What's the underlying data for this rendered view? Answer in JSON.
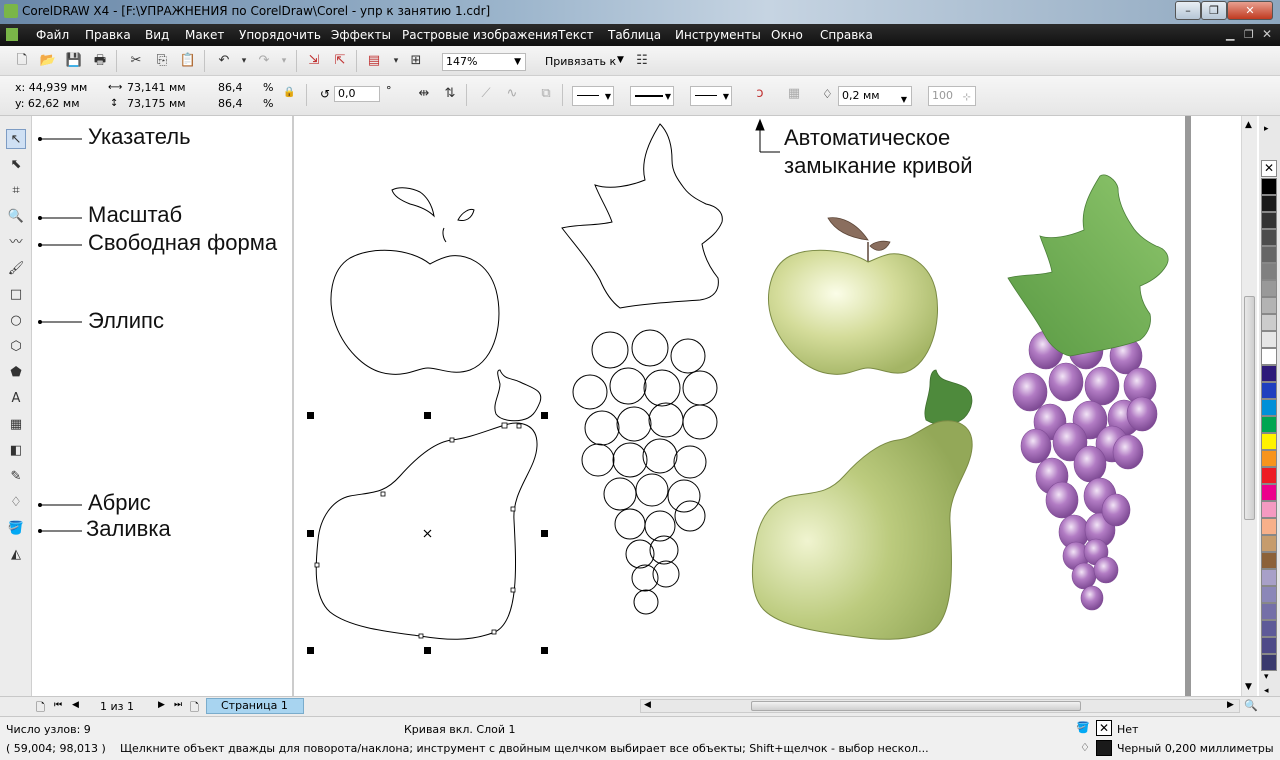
{
  "window": {
    "title": "CorelDRAW X4 - [F:\\УПРАЖНЕНИЯ по CorelDraw\\Corel - упр к занятию 1.cdr]",
    "controls": [
      "–",
      "❐",
      "✕"
    ]
  },
  "menu": [
    "Файл",
    "Правка",
    "Вид",
    "Макет",
    "Упорядочить",
    "Эффекты",
    "Растровые изображения",
    "Текст",
    "Таблица",
    "Инструменты",
    "Окно",
    "Справка"
  ],
  "toolbar": {
    "zoom": "147%",
    "snap_label": "Привязать к"
  },
  "property_bar": {
    "x": "x: 44,939 мм",
    "y": "y: 62,62 мм",
    "width": "73,141 мм",
    "height": "73,175 мм",
    "scale_x": "86,4",
    "scale_y": "86,4",
    "percent": "%",
    "rotation": "0,0",
    "degree": "°",
    "outline_width": "0,2 мм",
    "smoothing": "100"
  },
  "callouts": {
    "pointer": "Указатель",
    "zoom": "Масштаб",
    "freehand": "Свободная форма",
    "ellipse": "Эллипс",
    "outline": "Абрис",
    "fill": "Заливка",
    "auto_close_1": "Автоматическое",
    "auto_close_2": "замыкание кривой"
  },
  "page_nav": {
    "counter": "1 из 1",
    "tab": "Страница 1"
  },
  "status": {
    "nodes": "Число узлов: 9",
    "object": "Кривая вкл. Слой 1",
    "fill_label": "Нет",
    "coords": "( 59,004; 98,013 )",
    "hint": "Щелкните объект дважды для поворота/наклона; инструмент с двойным щелчком выбирает все объекты; Shift+щелчок - выбор нескол...",
    "outline_label": "Черный  0,200 миллиметры"
  },
  "palette": [
    "#000000",
    "#1a1a1a",
    "#333333",
    "#4d4d4d",
    "#666666",
    "#808080",
    "#999999",
    "#b3b3b3",
    "#cccccc",
    "#e6e6e6",
    "#ffffff",
    "#2e1a7a",
    "#1f3fbf",
    "#0090d8",
    "#00a651",
    "#fff200",
    "#f7941d",
    "#ed1c24",
    "#ec008c",
    "#f49ac1",
    "#f7b08a",
    "#c69c6d",
    "#8c6239",
    "#a8a0c8",
    "#8b87b8",
    "#7570a8",
    "#5e5a98",
    "#4e4a88",
    "#3a3a6e"
  ],
  "colors": {
    "menubar": "#1a1a1a",
    "apple": "#c7d48a",
    "pear": "#a9bd68",
    "grape": "#9a62b0",
    "leaf": "#6fae55",
    "selected_tab": "#a8d4f0"
  }
}
